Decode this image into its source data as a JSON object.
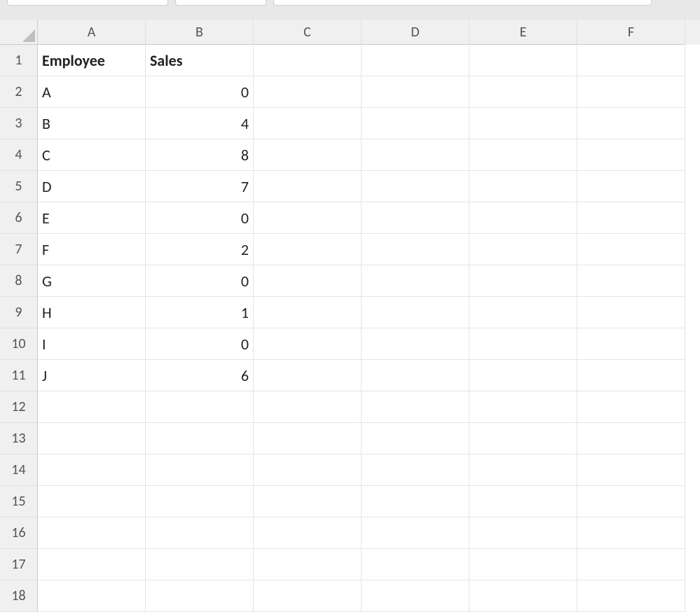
{
  "columns": [
    "A",
    "B",
    "C",
    "D",
    "E",
    "F"
  ],
  "rowCount": 18,
  "headers": {
    "A": "Employee",
    "B": "Sales"
  },
  "data": {
    "A": [
      "A",
      "B",
      "C",
      "D",
      "E",
      "F",
      "G",
      "H",
      "I",
      "J"
    ],
    "B": [
      0,
      4,
      8,
      7,
      0,
      2,
      0,
      1,
      0,
      6
    ]
  }
}
